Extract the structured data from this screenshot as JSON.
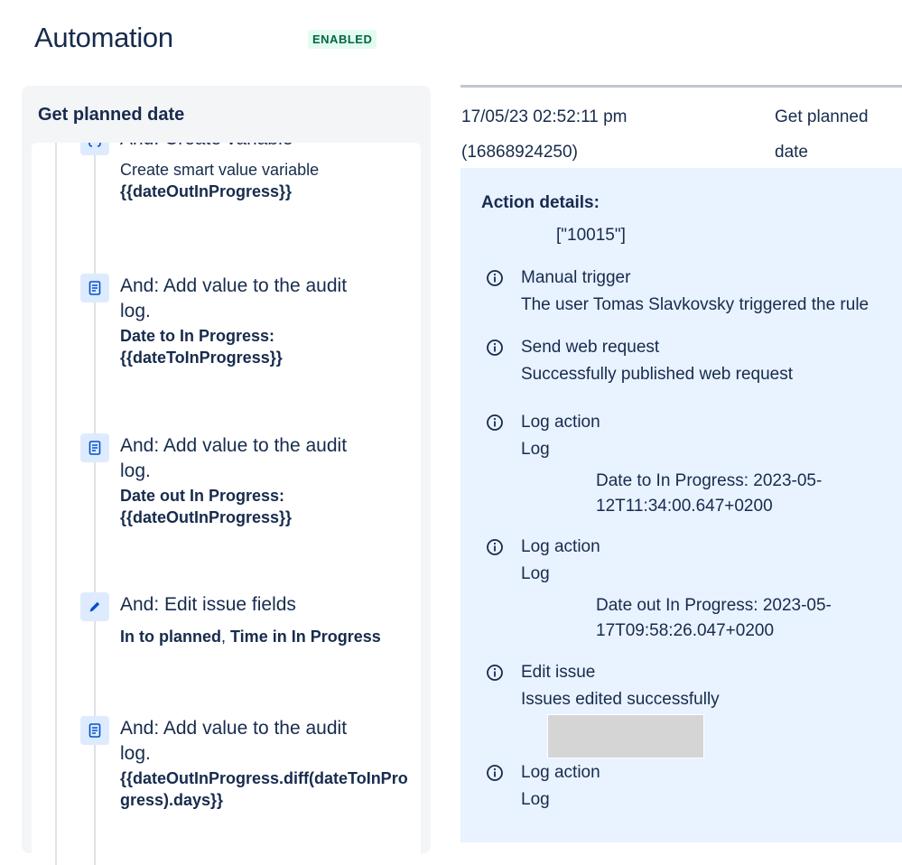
{
  "header": {
    "title": "Automation",
    "status": "ENABLED"
  },
  "rule": {
    "name": "Get planned date",
    "components": [
      {
        "icon": "variable-icon",
        "title": "And: Create variable",
        "detail": "Create smart value variable",
        "detail_bold": "{{dateOutInProgress}}"
      },
      {
        "icon": "log-icon",
        "title": "And: Add value to the audit log.",
        "detail_bold": "Date to In Progress: {{dateToInProgress}}"
      },
      {
        "icon": "log-icon",
        "title": "And: Add value to the audit log.",
        "detail_bold": "Date out In Progress: {{dateOutInProgress}}"
      },
      {
        "icon": "pencil-icon",
        "title": "And: Edit issue fields",
        "field_1": "In to planned",
        "separator": ", ",
        "field_2": "Time in In Progress"
      },
      {
        "icon": "log-icon",
        "title": "And: Add value to the audit log.",
        "detail_bold": "{{dateOutInProgress.diff(dateToInProgress).days}}"
      }
    ]
  },
  "audit": {
    "date": "17/05/23 02:52:11 pm",
    "id": "(16868924250)",
    "rule_name": "Get planned date",
    "details": {
      "heading": "Action details:",
      "value": "[\"10015\"]",
      "entries": [
        {
          "icon": "info-icon",
          "title": "Manual trigger",
          "description": "The user Tomas Slavkovsky triggered the rule"
        },
        {
          "icon": "info-icon",
          "title": "Send web request",
          "description": "Successfully published web request"
        },
        {
          "icon": "info-icon",
          "title": "Log action",
          "description": "Log",
          "log": "Date to In Progress: 2023-05-12T11:34:00.647+0200"
        },
        {
          "icon": "info-icon",
          "title": "Log action",
          "description": "Log",
          "log": "Date out In Progress: 2023-05-17T09:58:26.047+0200"
        },
        {
          "icon": "info-icon",
          "title": "Edit issue",
          "description": "Issues edited successfully"
        },
        {
          "icon": "info-icon",
          "title": "Log action",
          "description": "Log"
        }
      ]
    }
  },
  "colors": {
    "text": "#172b4d",
    "badge_bg": "#e3fcef",
    "badge_text": "#006644",
    "panel_bg": "#f4f5f7",
    "details_bg": "#e9f2ff",
    "icon_bg": "#deebff",
    "icon_fg": "#0052cc"
  }
}
